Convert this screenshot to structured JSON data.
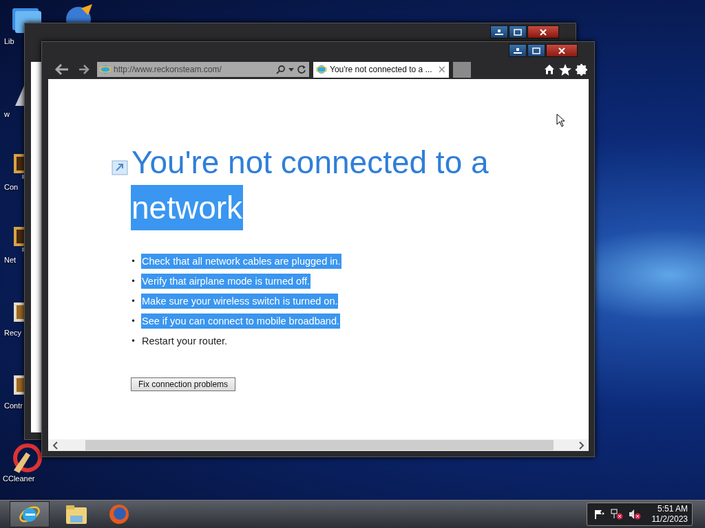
{
  "desktop_icons": [
    {
      "label": "Lib",
      "kind": "library"
    },
    {
      "label": "w",
      "kind": "triangle"
    },
    {
      "label": "Con",
      "kind": "monitor"
    },
    {
      "label": "Net",
      "kind": "monitor"
    },
    {
      "label": "Recy",
      "kind": "photo"
    },
    {
      "label": "Contr",
      "kind": "photo"
    },
    {
      "label": "CCleaner",
      "kind": "cleaner"
    }
  ],
  "browser": {
    "address": "http://www.reckonsteam.com/",
    "tabs": [
      {
        "title": "You're not connected to a ...",
        "close": "×",
        "selected": true
      }
    ],
    "heading": [
      {
        "text": "You're not connected to a",
        "selected": false
      },
      {
        "text": "network",
        "selected": true
      }
    ],
    "bullet": "•",
    "tips": [
      {
        "text": "Check that all network cables are plugged in.",
        "selected": true
      },
      {
        "text": "Verify that airplane mode is turned off.",
        "selected": true
      },
      {
        "text": "Make sure your wireless switch is turned on.",
        "selected": true
      },
      {
        "text": "See if you can connect to mobile broadband.",
        "selected": true
      },
      {
        "text": "Restart your router.",
        "selected": false
      }
    ],
    "fix_button": "Fix connection problems"
  },
  "taskbar": {
    "apps": [
      {
        "kind": "ie",
        "selected": true
      },
      {
        "kind": "folder",
        "selected": false
      },
      {
        "kind": "firefox",
        "selected": false
      }
    ],
    "time": "5:51 AM",
    "date": "11/2/2023"
  }
}
